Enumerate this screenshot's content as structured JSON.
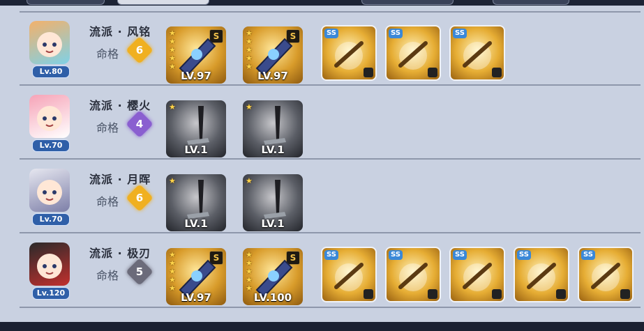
{
  "rows": [
    {
      "school_label": "流派 · 风铭",
      "mingge_label": "命格",
      "mingge_value": "6",
      "mingge_color": "#f0b020",
      "level": "Lv.80",
      "avatar_colors": [
        "#f3b16b",
        "#7fd1e6"
      ],
      "weapons": [
        {
          "level": "LV.97",
          "stars": 5,
          "grade": "S",
          "bg": "gold",
          "icon_name": "armored-bird-helm-icon"
        },
        {
          "level": "LV.97",
          "stars": 5,
          "grade": "S",
          "bg": "gold",
          "icon_name": "blue-bird-icon"
        }
      ],
      "ss_items": [
        {
          "tag": "SS",
          "icon_name": "mask-icon"
        },
        {
          "tag": "SS",
          "icon_name": "book-icon"
        },
        {
          "tag": "SS",
          "icon_name": "golden-sword-icon"
        }
      ]
    },
    {
      "school_label": "流派 · 樱火",
      "mingge_label": "命格",
      "mingge_value": "4",
      "mingge_color": "#8a5fd0",
      "level": "Lv.70",
      "avatar_colors": [
        "#f6a3b7",
        "#ffffff"
      ],
      "weapons": [
        {
          "level": "LV.1",
          "stars": 1,
          "grade": "",
          "bg": "dark",
          "icon_name": "braided-sword-hilt-icon"
        },
        {
          "level": "LV.1",
          "stars": 1,
          "grade": "",
          "bg": "dark",
          "icon_name": "wooden-sword-icon"
        }
      ],
      "ss_items": []
    },
    {
      "school_label": "流派 · 月晖",
      "mingge_label": "命格",
      "mingge_value": "6",
      "mingge_color": "#f0b020",
      "level": "Lv.70",
      "avatar_colors": [
        "#e6e7f0",
        "#7d7fa8"
      ],
      "weapons": [
        {
          "level": "LV.1",
          "stars": 1,
          "grade": "",
          "bg": "dark",
          "icon_name": "braided-sword-hilt-icon"
        },
        {
          "level": "LV.1",
          "stars": 1,
          "grade": "",
          "bg": "dark",
          "icon_name": "braided-sword-hilt-icon"
        }
      ],
      "ss_items": []
    },
    {
      "school_label": "流派 · 极刃",
      "mingge_label": "命格",
      "mingge_value": "5",
      "mingge_color": "#6b6b7a",
      "level": "Lv.120",
      "avatar_colors": [
        "#2a2a2a",
        "#c2302e"
      ],
      "weapons": [
        {
          "level": "LV.97",
          "stars": 5,
          "grade": "S",
          "bg": "gold",
          "icon_name": "blue-spear-icon"
        },
        {
          "level": "LV.100",
          "stars": 5,
          "grade": "S",
          "bg": "gold",
          "icon_name": "green-blade-icon"
        }
      ],
      "ss_items": [
        {
          "tag": "SS",
          "icon_name": "golden-hook-icon"
        },
        {
          "tag": "SS",
          "icon_name": "dragon-armor-icon"
        },
        {
          "tag": "SS",
          "icon_name": "blue-gem-blade-icon"
        },
        {
          "tag": "SS",
          "icon_name": "red-flame-sword-icon"
        },
        {
          "tag": "SS",
          "icon_name": "red-shield-icon"
        }
      ]
    }
  ]
}
